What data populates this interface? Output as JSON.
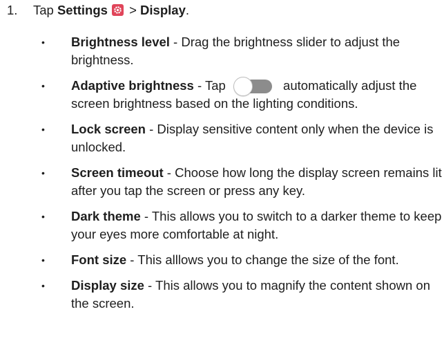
{
  "step": {
    "number": "1.",
    "prefix": "Tap ",
    "settings_label": "Settings",
    "separator": " > ",
    "display_label": "Display",
    "suffix": "."
  },
  "icons": {
    "settings": "settings-gear-icon",
    "toggle": "toggle-switch-icon"
  },
  "colors": {
    "settings_icon_bg": "#e0455a",
    "toggle_track": "#8c8c8c"
  },
  "bullets": [
    {
      "title": "Brightness level",
      "text": " - Drag the brightness slider to adjust the brightness."
    },
    {
      "title": "Adaptive brightness",
      "text_before": " - Tap ",
      "text_after": " automatically adjust the screen brightness based on the lighting conditions."
    },
    {
      "title": "Lock screen",
      "text": " - Display sensitive content only when the device is unlocked."
    },
    {
      "title": "Screen timeout",
      "text": " - Choose how long the display screen remains lit after you tap the screen or press any key."
    },
    {
      "title": "Dark theme",
      "text": " - This allows you to switch to a darker theme to keep your eyes more comfortable at night."
    },
    {
      "title": "Font size",
      "text": " - This alllows you to change the size of the font."
    },
    {
      "title": "Display size",
      "text": " - This allows you to magnify the content shown on the screen."
    }
  ],
  "bullet_symbol": "•"
}
